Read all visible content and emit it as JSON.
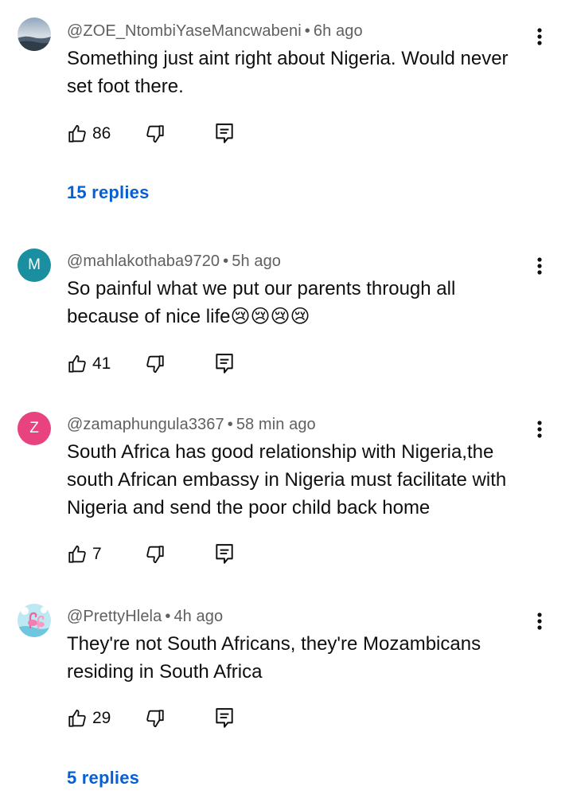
{
  "comments": [
    {
      "handle": "@ZOE_NtombiYaseMancwabeni",
      "time": "6h ago",
      "text": "Something just aint right about Nigeria. Would never\nset foot there.",
      "likes": "86",
      "replies": "15 replies",
      "avatar": {
        "type": "image",
        "colors": [
          "#6f8aa5",
          "#c7cfd8",
          "#3d4e5e"
        ]
      }
    },
    {
      "handle": "@mahlakothaba9720",
      "time": "5h ago",
      "text": "So painful what we put our parents through all\nbecause of nice life😢😢😢😢",
      "likes": "41",
      "avatar": {
        "type": "letter",
        "letter": "M",
        "color": "#1a8fa0"
      }
    },
    {
      "handle": "@zamaphungula3367",
      "time": "58 min ago",
      "text": "South Africa has good relationship with Nigeria,the\nsouth African embassy in Nigeria must facilitate with\nNigeria and send the poor child back home",
      "likes": "7",
      "avatar": {
        "type": "letter",
        "letter": "Z",
        "color": "#e8437e"
      }
    },
    {
      "handle": "@PrettyHlela",
      "time": "4h ago",
      "text": "They're not South Africans, they're Mozambicans\nresiding in South Africa",
      "likes": "29",
      "replies": "5 replies",
      "avatar": {
        "type": "image",
        "colors": [
          "#aee3ef",
          "#e86aa5",
          "#f4a0c5"
        ]
      }
    }
  ],
  "icons": {
    "more": "more-vert-icon",
    "like": "thumb-up-icon",
    "dislike": "thumb-down-icon",
    "reply": "comment-reply-icon"
  },
  "colors": {
    "link": "#065fd4",
    "meta": "#606060",
    "text": "#0f0f0f"
  }
}
